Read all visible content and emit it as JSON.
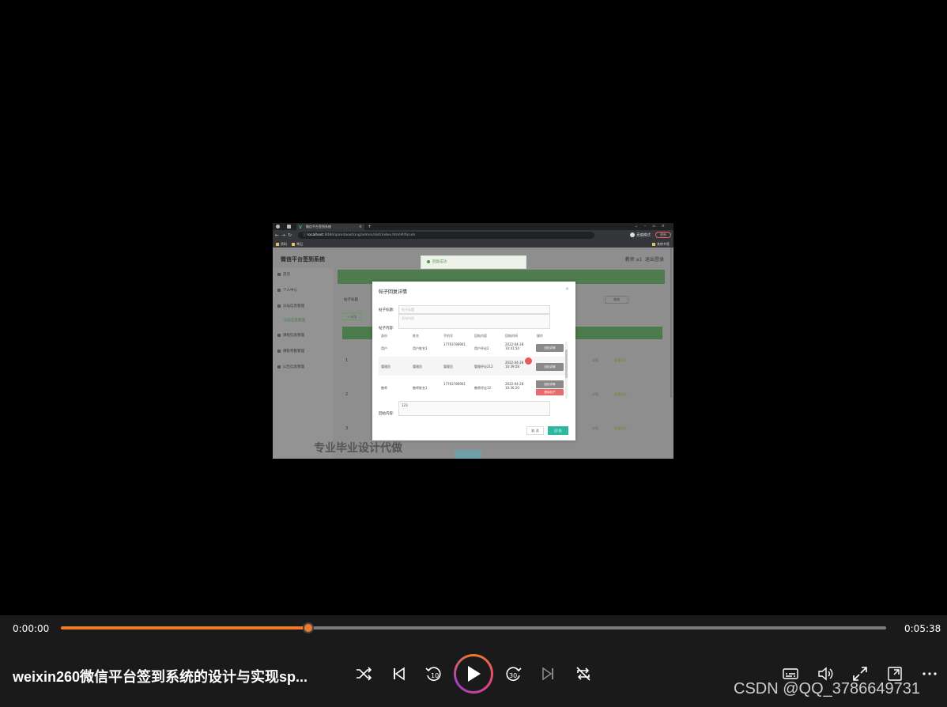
{
  "browser": {
    "tab_title": "微信平台签到系统",
    "url_host": "localhost",
    "url_path": ":8080/qiandaoxitong/admin/dist/index.html#/forum",
    "incognito_label": "无痕模式",
    "update_label": "更新",
    "bookmarks": [
      "资料",
      "常见"
    ],
    "other_bookmarks": "其他书签"
  },
  "app": {
    "title": "微信平台签到系统",
    "user_label": "教师 a1",
    "logout": "退出登录",
    "sidebar": [
      "首页",
      "个人中心",
      "论坛信息管理",
      "论坛信息管理",
      "课程信息管理",
      "课程考勤管理",
      "公告信息管理"
    ],
    "filter_label": "帖子标题",
    "search_button": "查询",
    "add_button": "+ 新增",
    "rows": [
      "1",
      "2",
      "3"
    ],
    "row_actions": [
      "详情",
      "查看评论"
    ],
    "toast": "回复成功"
  },
  "dialog": {
    "title": "帖子回复详情",
    "close": "×",
    "post_title_label": "帖子标题:",
    "post_title_placeholder": "帖子标题",
    "content_placeholder": "发布内容",
    "post_content_label": "帖子内容:",
    "columns": [
      "身份",
      "姓名",
      "手机号",
      "回帖内容",
      "回帖时间",
      "操作"
    ],
    "replies": [
      {
        "role": "用户",
        "name": "用户姓名1",
        "phone": "17703786901",
        "content": "用户评论2",
        "time": "2022-04-28 10:41:54",
        "action": "回帖详情"
      },
      {
        "role": "管理员",
        "name": "管理员",
        "phone": "管理员",
        "content": "管理评论212",
        "time": "2022-04-28 10:39:58",
        "action": "回帖详情"
      },
      {
        "role": "教师",
        "name": "教师姓名1",
        "phone": "17703786901",
        "content": "教师评论12",
        "time": "2022-04-28 10:36:20",
        "action": "回帖详情",
        "delete": "删除帖子"
      }
    ],
    "reply_value": "123",
    "reply_label": "回帖内容:",
    "cancel": "取 消",
    "submit": "回 帖"
  },
  "video_watermark": "专业毕业设计代做",
  "player": {
    "current_time": "0:00:00",
    "duration": "0:05:38",
    "progress": 0.3,
    "title": "weixin260微信平台签到系统的设计与实现sp...",
    "accent": "#f07a2a",
    "watermark": "CSDN @QQ_3786649731",
    "icons": [
      "shuffle-icon",
      "previous-icon",
      "rewind-10-icon",
      "play-icon",
      "forward-30-icon",
      "next-icon",
      "repeat-icon",
      "captions-icon",
      "volume-icon",
      "fullscreen-icon",
      "mini-player-icon",
      "more-icon"
    ]
  }
}
